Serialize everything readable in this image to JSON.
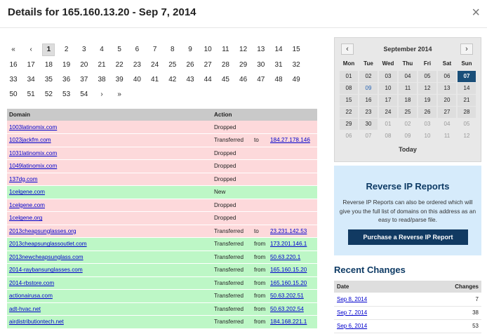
{
  "header": {
    "title": "Details for 165.160.13.20 - Sep 7, 2014",
    "close": "×"
  },
  "pager": {
    "first": "«",
    "prev": "‹",
    "next": "›",
    "last": "»",
    "active": "1",
    "pages": [
      "1",
      "2",
      "3",
      "4",
      "5",
      "6",
      "7",
      "8",
      "9",
      "10",
      "11",
      "12",
      "13",
      "14",
      "15",
      "16",
      "17",
      "18",
      "19",
      "20",
      "21",
      "22",
      "23",
      "24",
      "25",
      "26",
      "27",
      "28",
      "29",
      "30",
      "31",
      "32",
      "33",
      "34",
      "35",
      "36",
      "37",
      "38",
      "39",
      "40",
      "41",
      "42",
      "43",
      "44",
      "45",
      "46",
      "47",
      "48",
      "49",
      "50",
      "51",
      "52",
      "53",
      "54"
    ]
  },
  "domains": {
    "headers": {
      "domain": "Domain",
      "action": "Action"
    },
    "rows": [
      {
        "domain": "1003latinomix.com",
        "action": "Dropped",
        "dir": "",
        "ip": "",
        "kind": "dropped"
      },
      {
        "domain": "1023jackfm.com",
        "action": "Transferred",
        "dir": "to",
        "ip": "184.27.178.146",
        "kind": "to"
      },
      {
        "domain": "1031latinomix.com",
        "action": "Dropped",
        "dir": "",
        "ip": "",
        "kind": "dropped"
      },
      {
        "domain": "1049latinomix.com",
        "action": "Dropped",
        "dir": "",
        "ip": "",
        "kind": "dropped"
      },
      {
        "domain": "137dg.com",
        "action": "Dropped",
        "dir": "",
        "ip": "",
        "kind": "dropped"
      },
      {
        "domain": "1celgene.com",
        "action": "New",
        "dir": "",
        "ip": "",
        "kind": "newrow"
      },
      {
        "domain": "1celgene.com",
        "action": "Dropped",
        "dir": "",
        "ip": "",
        "kind": "dropped"
      },
      {
        "domain": "1celgene.org",
        "action": "Dropped",
        "dir": "",
        "ip": "",
        "kind": "dropped"
      },
      {
        "domain": "2013cheapsunglasses.org",
        "action": "Transferred",
        "dir": "to",
        "ip": "23.231.142.53",
        "kind": "to"
      },
      {
        "domain": "2013cheapsunglassoutlet.com",
        "action": "Transferred",
        "dir": "from",
        "ip": "173.201.146.1",
        "kind": "from"
      },
      {
        "domain": "2013newcheapsunglass.com",
        "action": "Transferred",
        "dir": "from",
        "ip": "50.63.220.1",
        "kind": "from"
      },
      {
        "domain": "2014-raybansunglasses.com",
        "action": "Transferred",
        "dir": "from",
        "ip": "165.160.15.20",
        "kind": "from"
      },
      {
        "domain": "2014-rbstore.com",
        "action": "Transferred",
        "dir": "from",
        "ip": "165.160.15.20",
        "kind": "from"
      },
      {
        "domain": "actionairusa.com",
        "action": "Transferred",
        "dir": "from",
        "ip": "50.63.202.51",
        "kind": "from"
      },
      {
        "domain": "adt-hvac.net",
        "action": "Transferred",
        "dir": "from",
        "ip": "50.63.202.54",
        "kind": "from"
      },
      {
        "domain": "airdistributiontech.net",
        "action": "Transferred",
        "dir": "from",
        "ip": "184.168.221.1",
        "kind": "from"
      }
    ]
  },
  "calendar": {
    "title": "September 2014",
    "prev": "‹",
    "next": "›",
    "today_label": "Today",
    "dow": [
      "Mon",
      "Tue",
      "Wed",
      "Thu",
      "Fri",
      "Sat",
      "Sun"
    ],
    "weeks": [
      [
        "01",
        "02",
        "03",
        "04",
        "05",
        "06",
        "07"
      ],
      [
        "08",
        "09",
        "10",
        "11",
        "12",
        "13",
        "14"
      ],
      [
        "15",
        "16",
        "17",
        "18",
        "19",
        "20",
        "21"
      ],
      [
        "22",
        "23",
        "24",
        "25",
        "26",
        "27",
        "28"
      ],
      [
        "29",
        "30",
        "01",
        "02",
        "03",
        "04",
        "05"
      ],
      [
        "06",
        "07",
        "08",
        "09",
        "10",
        "11",
        "12"
      ]
    ],
    "current_month_through_index": 29,
    "today_index": 6,
    "highlight_index": 8
  },
  "reverse_ip": {
    "title": "Reverse IP Reports",
    "text": "Reverse IP Reports can also be ordered which will give you the full list of domains on this address as an easy to read/parse file.",
    "button": "Purchase a Reverse IP Report"
  },
  "recent_changes": {
    "title": "Recent Changes",
    "headers": {
      "date": "Date",
      "changes": "Changes"
    },
    "rows": [
      {
        "date": "Sep 8, 2014",
        "changes": "7"
      },
      {
        "date": "Sep 7, 2014",
        "changes": "38"
      },
      {
        "date": "Sep 6, 2014",
        "changes": "53"
      }
    ]
  },
  "colors": {
    "dropped": "#fdd9db",
    "transferred_from": "#bdf7c6",
    "accent": "#113a62",
    "link": "#0000cc"
  }
}
